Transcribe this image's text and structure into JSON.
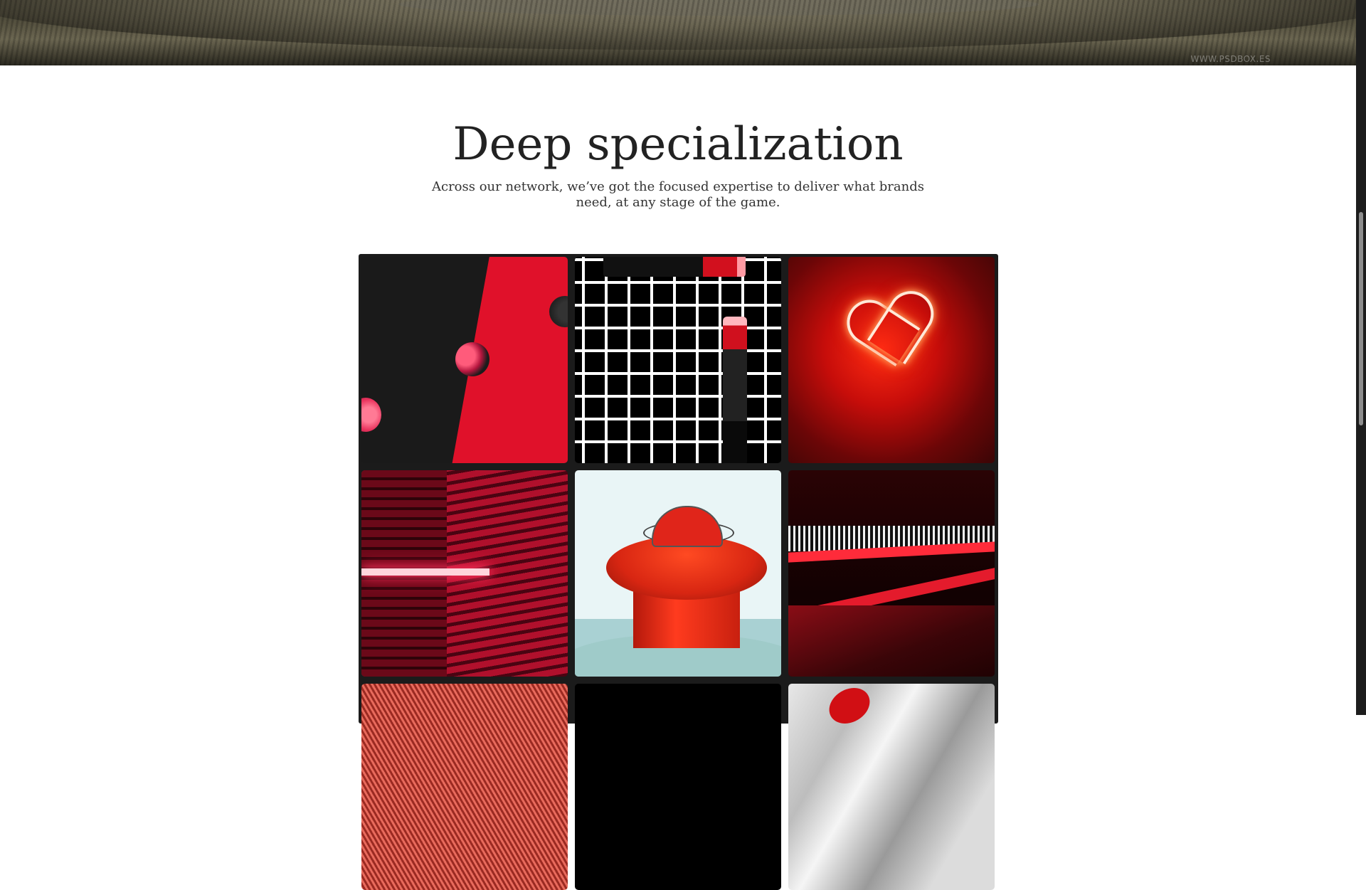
{
  "hero": {
    "watermark": "WWW.PSDBOX.ES"
  },
  "section": {
    "title": "Deep specialization",
    "subtitle": "Across our network, we’ve got the focused expertise to deliver what brands need, at any stage of the game."
  }
}
